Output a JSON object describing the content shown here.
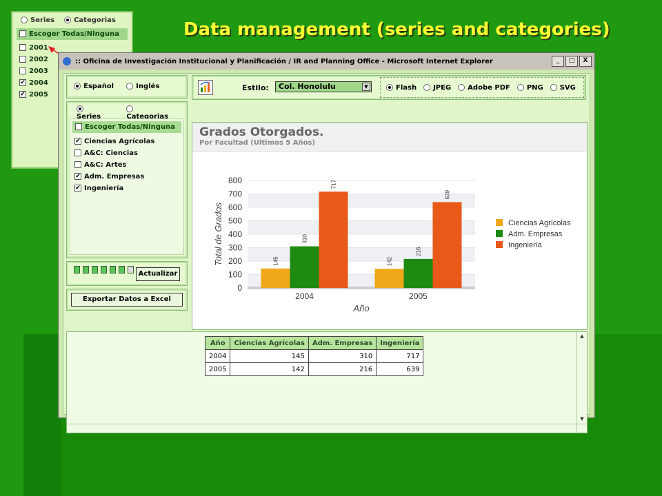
{
  "slide_title": "Data management (series and categories)",
  "mini_panel": {
    "radio_series": "Series",
    "radio_categories": "Categorias",
    "select_all": "Escoger Todas/Ninguna",
    "years": [
      {
        "label": "2001",
        "checked": false
      },
      {
        "label": "2002",
        "checked": false
      },
      {
        "label": "2003",
        "checked": false
      },
      {
        "label": "2004",
        "checked": true
      },
      {
        "label": "2005",
        "checked": true
      }
    ]
  },
  "window": {
    "title": ":: Oficina de Investigación Institucional y Planificación / IR and Planning Office - Microsoft Internet Explorer",
    "buttons": {
      "min": "_",
      "max": "□",
      "close": "X"
    }
  },
  "lang": {
    "es": "Español",
    "en": "Inglés"
  },
  "series_panel": {
    "radio_series": "Series",
    "radio_categories": "Categorias",
    "items": [
      {
        "label": "Escoger Todas/Ninguna",
        "checked": false
      },
      {
        "label": "Ciencias Agrícolas",
        "checked": true
      },
      {
        "label": "A&C: Ciencias",
        "checked": false
      },
      {
        "label": "A&C: Artes",
        "checked": false
      },
      {
        "label": "Adm. Empresas",
        "checked": true
      },
      {
        "label": "Ingeniería",
        "checked": true
      }
    ]
  },
  "buttons": {
    "update": "Actualizar",
    "export": "Exportar Datos a Excel"
  },
  "toolbar": {
    "style_label": "Estilo:",
    "style_value": "Col. Honolulu",
    "formats": [
      {
        "label": "Flash",
        "selected": true
      },
      {
        "label": "JPEG",
        "selected": false
      },
      {
        "label": "Adobe PDF",
        "selected": false
      },
      {
        "label": "PNG",
        "selected": false
      },
      {
        "label": "SVG",
        "selected": false
      }
    ]
  },
  "chart_data": {
    "type": "bar",
    "title": "Grados Otorgados.",
    "subtitle": "Por Facultad (Ultimos 5 Años)",
    "xlabel": "Año",
    "ylabel": "Total de Grados",
    "ylim": [
      0,
      800
    ],
    "yticks": [
      0,
      100,
      200,
      300,
      400,
      500,
      600,
      700,
      800
    ],
    "categories": [
      "2004",
      "2005"
    ],
    "series": [
      {
        "name": "Ciencias Agrícolas",
        "color": "#f0a81a",
        "values": [
          145,
          142
        ]
      },
      {
        "name": "Adm. Empresas",
        "color": "#1f8a12",
        "values": [
          310,
          216
        ]
      },
      {
        "name": "Ingeniería",
        "color": "#e8591a",
        "values": [
          717,
          639
        ]
      }
    ],
    "legend": "right"
  },
  "table": {
    "headers": [
      "Año",
      "Ciencias Agrícolas",
      "Adm. Empresas",
      "Ingeniería"
    ],
    "rows": [
      [
        "2004",
        "145",
        "310",
        "717"
      ],
      [
        "2005",
        "142",
        "216",
        "639"
      ]
    ]
  }
}
